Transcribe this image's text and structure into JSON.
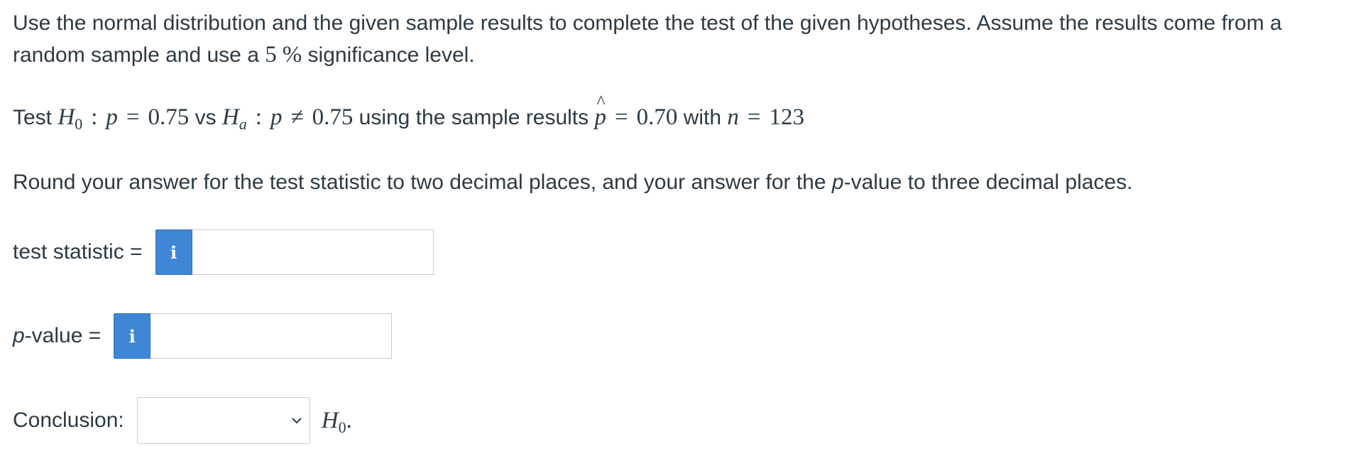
{
  "intro": {
    "line1": "Use the normal distribution and the given sample results to complete the test of the given hypotheses. Assume the results come from a",
    "line2_pre": "random sample and use a ",
    "line2_num": "5",
    "line2_pct": "%",
    "line2_post": " significance level."
  },
  "test": {
    "word_test": "Test ",
    "h": "H",
    "h0_sub": "0",
    "colon": ":",
    "p": "p",
    "eq": "=",
    "p0_value": "0.75",
    "vs": " vs ",
    "ha_sub": "a",
    "neq": "≠",
    "pa_value": "0.75",
    "using": " using the sample results ",
    "hat": "^",
    "phat_value": "0.70",
    "with": " with ",
    "n": "n",
    "n_value": "123"
  },
  "rounding": {
    "pre": "Round your answer for the test statistic to two decimal places, and your answer for the ",
    "p_italic": "p",
    "post": "-value to three decimal places."
  },
  "test_statistic": {
    "label": "test statistic =",
    "info_glyph": "i",
    "value": ""
  },
  "p_value": {
    "label_italic": "p",
    "label_rest": "-value =",
    "info_glyph": "i",
    "value": ""
  },
  "conclusion": {
    "label": "Conclusion:",
    "selected": "",
    "after_h": "H",
    "after_sub": "0",
    "after_dot": "."
  },
  "colors": {
    "info_button": "#3f87d6",
    "text": "#2d3b45",
    "border": "#c7cdd1"
  }
}
